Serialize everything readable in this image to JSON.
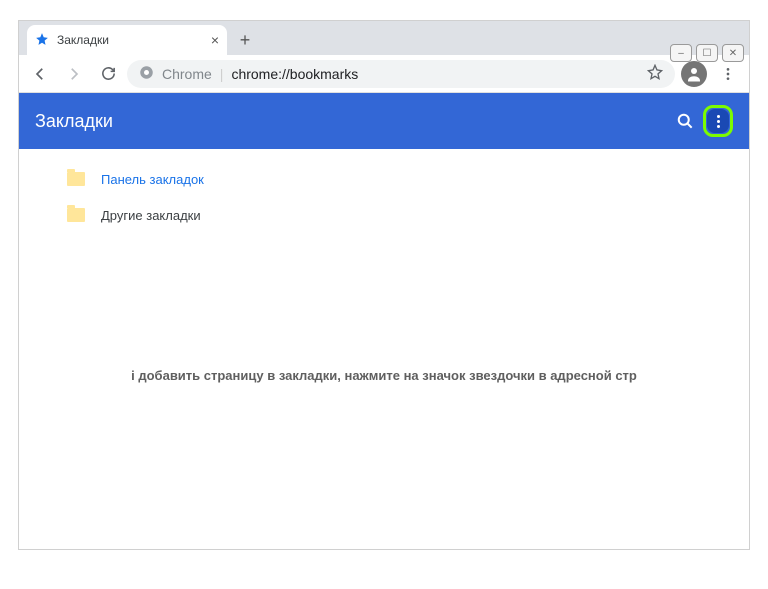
{
  "window_controls": {
    "minimize": "–",
    "maximize": "☐",
    "close": "✕"
  },
  "tab": {
    "title": "Закладки",
    "favicon": "star",
    "close": "×",
    "new_tab": "+"
  },
  "toolbar": {
    "omnibox": {
      "site_icon": "chrome",
      "origin": "Chrome",
      "divider": "|",
      "path": "chrome://bookmarks"
    }
  },
  "page": {
    "header_title": "Закладки",
    "folders": [
      {
        "label": "Панель закладок",
        "active": true
      },
      {
        "label": "Другие закладки",
        "active": false
      }
    ],
    "hint": "і добавить страницу в закладки, нажмите на значок звездочки в адресной стр"
  },
  "colors": {
    "header_blue": "#3367d6",
    "active_link": "#1a73e8",
    "highlight_green": "#7cfc00",
    "folder_yellow": "#ffe69a"
  }
}
